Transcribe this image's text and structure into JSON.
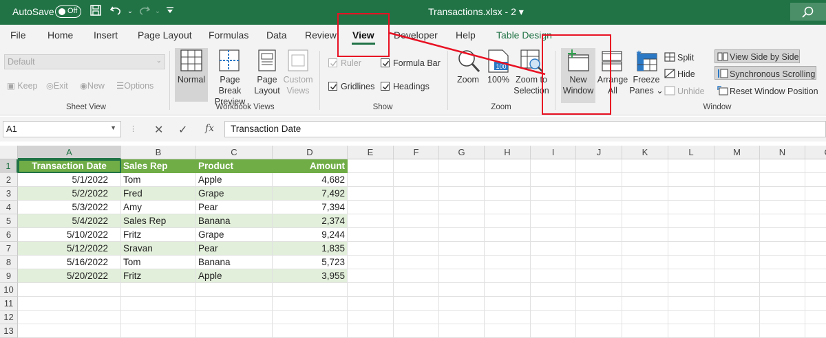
{
  "titlebar": {
    "autosave_label": "AutoSave",
    "autosave_state": "Off",
    "doc_title": "Transactions.xlsx  -  2",
    "doc_title_caret": "▾",
    "icons": [
      "save-icon",
      "undo-icon",
      "redo-icon",
      "customize-qat-icon",
      "search-icon"
    ]
  },
  "tabs": [
    "File",
    "Home",
    "Insert",
    "Page Layout",
    "Formulas",
    "Data",
    "Review",
    "View",
    "Developer",
    "Help",
    "Table Design"
  ],
  "active_tab": "View",
  "ribbon": {
    "sheet_view": {
      "dropdown_value": "Default",
      "keep": "Keep",
      "exit": "Exit",
      "new": "New",
      "options": "Options",
      "label": "Sheet View"
    },
    "workbook_views": {
      "normal": "Normal",
      "page_break_1": "Page Break",
      "page_break_2": "Preview",
      "page_layout_1": "Page",
      "page_layout_2": "Layout",
      "custom_1": "Custom",
      "custom_2": "Views",
      "label": "Workbook Views"
    },
    "show": {
      "ruler": "Ruler",
      "formula_bar": "Formula Bar",
      "gridlines": "Gridlines",
      "headings": "Headings",
      "label": "Show",
      "ruler_checked": true,
      "formula_bar_checked": true,
      "gridlines_checked": true,
      "headings_checked": true
    },
    "zoom": {
      "zoom": "Zoom",
      "hundred": "100%",
      "hundred_badge": "100",
      "zoom_to_1": "Zoom to",
      "zoom_to_2": "Selection",
      "label": "Zoom"
    },
    "window": {
      "new_window_1": "New",
      "new_window_2": "Window",
      "arrange_1": "Arrange",
      "arrange_2": "All",
      "freeze_1": "Freeze",
      "freeze_2": "Panes ⌄",
      "split": "Split",
      "hide": "Hide",
      "unhide": "Unhide",
      "view_side": "View Side by Side",
      "sync_scroll": "Synchronous Scrolling",
      "reset_pos": "Reset Window Position",
      "label": "Window"
    }
  },
  "formula_bar": {
    "name_box": "A1",
    "cancel": "✕",
    "enter": "✓",
    "fx": "fx",
    "content": "Transaction Date"
  },
  "sheet": {
    "columns": [
      "A",
      "B",
      "C",
      "D",
      "E",
      "F",
      "G",
      "H",
      "I",
      "J",
      "K",
      "L",
      "M",
      "N",
      "O"
    ],
    "row_numbers": [
      "1",
      "2",
      "3",
      "4",
      "5",
      "6",
      "7",
      "8",
      "9",
      "10",
      "11",
      "12",
      "13"
    ],
    "header": [
      "Transaction Date",
      "Sales Rep",
      "Product",
      "Amount"
    ],
    "rows": [
      [
        "5/1/2022",
        "Tom",
        "Apple",
        "4,682"
      ],
      [
        "5/2/2022",
        "Fred",
        "Grape",
        "7,492"
      ],
      [
        "5/3/2022",
        "Amy",
        "Pear",
        "7,394"
      ],
      [
        "5/4/2022",
        "Sales Rep",
        "Banana",
        "2,374"
      ],
      [
        "5/10/2022",
        "Fritz",
        "Grape",
        "9,244"
      ],
      [
        "5/12/2022",
        "Sravan",
        "Pear",
        "1,835"
      ],
      [
        "5/16/2022",
        "Tom",
        "Banana",
        "5,723"
      ],
      [
        "5/20/2022",
        "Fritz",
        "Apple",
        "3,955"
      ]
    ]
  },
  "colors": {
    "excel_green": "#217346",
    "table_header": "#70ad47",
    "table_band": "#e2efda",
    "annotation_red": "#e81123"
  }
}
